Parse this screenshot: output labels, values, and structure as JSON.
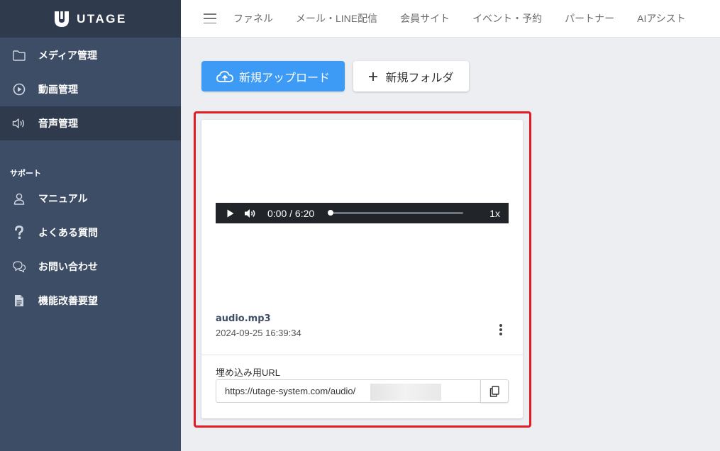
{
  "app": {
    "logo_text": "UTAGE"
  },
  "sidebar": {
    "items": [
      {
        "label": "メディア管理",
        "icon": "folder-icon"
      },
      {
        "label": "動画管理",
        "icon": "play-circle-icon"
      },
      {
        "label": "音声管理",
        "icon": "speaker-icon",
        "active": true
      }
    ],
    "support_label": "サポート",
    "support_items": [
      {
        "label": "マニュアル",
        "icon": "user-icon"
      },
      {
        "label": "よくある質問",
        "icon": "question-icon"
      },
      {
        "label": "お問い合わせ",
        "icon": "chat-icon"
      },
      {
        "label": "機能改善要望",
        "icon": "document-icon"
      }
    ]
  },
  "header": {
    "menu": [
      "ファネル",
      "メール・LINE配信",
      "会員サイト",
      "イベント・予約",
      "パートナー",
      "AIアシスト"
    ]
  },
  "toolbar": {
    "upload_label": "新規アップロード",
    "folder_label": "新規フォルダ"
  },
  "card": {
    "player": {
      "time": "0:00 / 6:20",
      "speed": "1x",
      "progress": 0
    },
    "file_name": "audio.mp3",
    "date": "2024-09-25 16:39:34",
    "embed_label": "埋め込み用URL",
    "embed_url": "https://utage-system.com/audio/"
  },
  "colors": {
    "sidebar_bg": "#3e4d66",
    "sidebar_dark": "#2f3a4d",
    "primary": "#3d9bf5",
    "highlight": "#e31b23"
  }
}
